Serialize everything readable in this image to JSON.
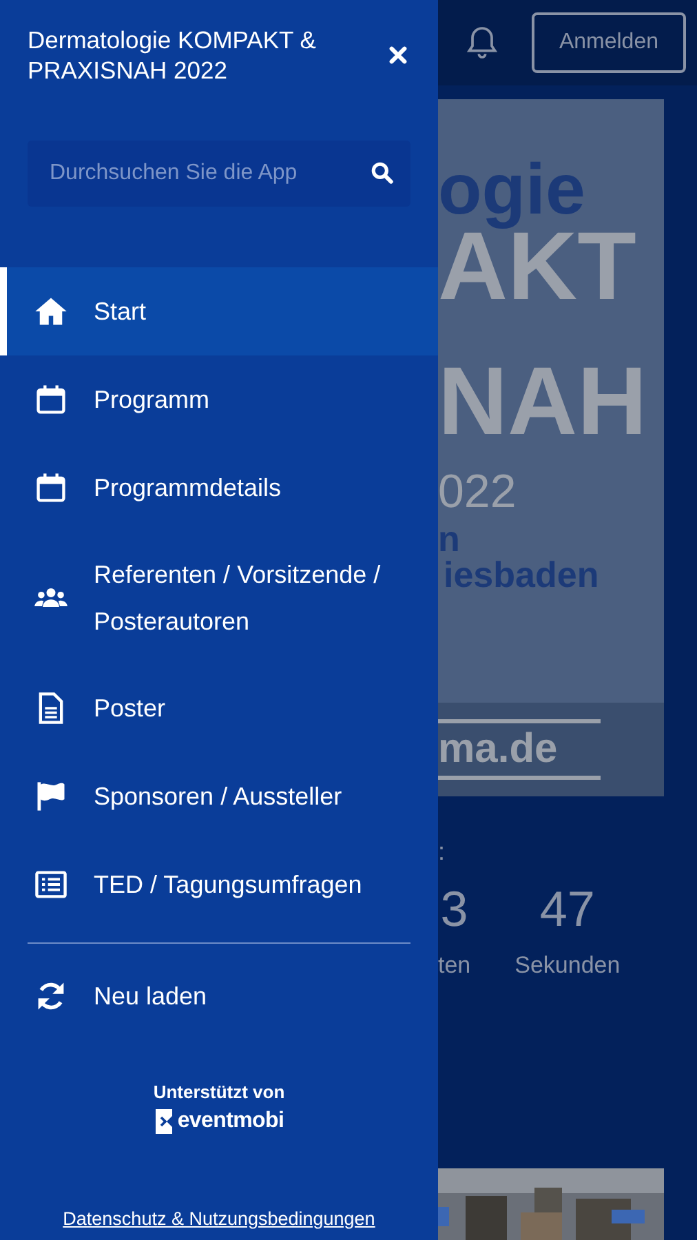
{
  "drawer": {
    "title": "Dermatologie KOMPAKT & PRAXISNAH 2022",
    "search": {
      "placeholder": "Durchsuchen Sie die App"
    },
    "items": [
      {
        "label": "Start",
        "selected": true
      },
      {
        "label": "Programm",
        "selected": false
      },
      {
        "label": "Programmdetails",
        "selected": false
      },
      {
        "label": "Referenten / Vorsitzende / Posterautoren",
        "selected": false
      },
      {
        "label": "Poster",
        "selected": false
      },
      {
        "label": "Sponsoren / Aussteller",
        "selected": false
      },
      {
        "label": "TED / Tagungsumfragen",
        "selected": false
      }
    ],
    "actions": [
      {
        "label": "Neu laden"
      }
    ],
    "powered_by": "Unterstützt von",
    "brand": "eventmobi",
    "footer_link": "Datenschutz & Nutzungsbedingungen"
  },
  "page": {
    "login_button": "Anmelden",
    "banner": {
      "lines": [
        "ogie",
        "AKT",
        "NAH",
        "022",
        "n",
        "iesbaden"
      ],
      "link": "ma.de"
    },
    "countdown": {
      "label_fragment": ":",
      "units": [
        {
          "value": "3",
          "label": "ten"
        },
        {
          "value": "47",
          "label": "Sekunden"
        }
      ]
    }
  }
}
